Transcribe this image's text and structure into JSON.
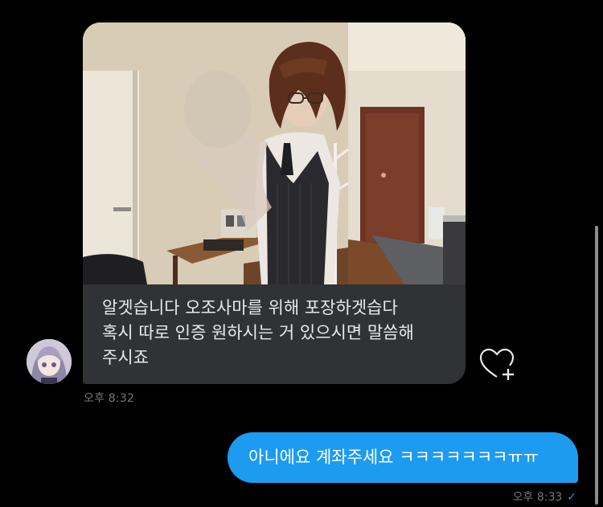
{
  "incoming": {
    "text": "알겟습니다 오조사마를 위해 포장하겟습다\n혹시 따로 인증 원하시는 거 있으시면 말씀해\n주시죠",
    "time": "오후 8:32"
  },
  "outgoing": {
    "text": "아니에요 계좌주세요 ㅋㅋㅋㅋㅋㅋㅋㅠㅠ",
    "time": "오후 8:33",
    "status_icon": "✓"
  },
  "icons": {
    "react": "heart-plus-icon"
  },
  "colors": {
    "background": "#000000",
    "incoming_bubble": "#2f3336",
    "outgoing_bubble": "#1d9bf0",
    "timestamp": "#71767b",
    "read_check": "#1d9bf0"
  }
}
